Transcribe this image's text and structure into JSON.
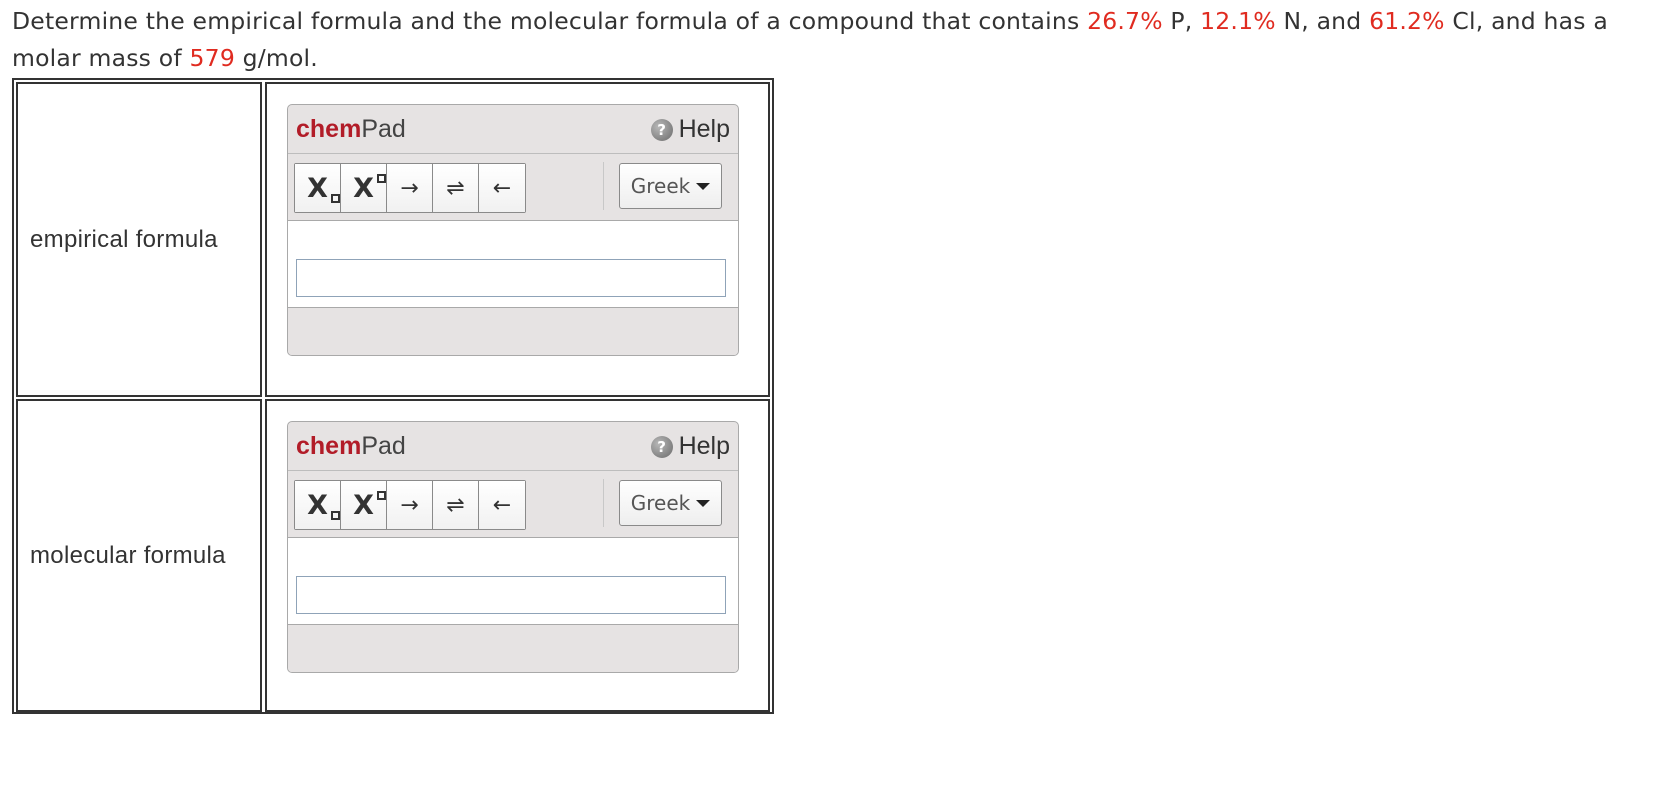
{
  "question": {
    "t1": "Determine the empirical formula and the molecular formula of a compound that contains ",
    "p_pct": "26.7%",
    "t2": " P, ",
    "n_pct": "12.1%",
    "t3": " N, and ",
    "cl_pct": "61.2%",
    "t4": " Cl, and has a molar mass of ",
    "molar_mass": "579",
    "t5": " g/mol."
  },
  "colors": {
    "highlight": "#e02b20",
    "brand_chem": "#b21c28"
  },
  "rows": [
    {
      "label": "empirical formula",
      "chempad": {
        "brand_bold": "chem",
        "brand_rest": "Pad",
        "help_label": "Help",
        "help_icon": "question-circle-icon",
        "tools": {
          "subscript": "X",
          "superscript": "X",
          "right_arrow": "→",
          "equilibrium": "⇌",
          "left_arrow": "←"
        },
        "greek_label": "Greek",
        "input_value": ""
      }
    },
    {
      "label": "molecular formula",
      "chempad": {
        "brand_bold": "chem",
        "brand_rest": "Pad",
        "help_label": "Help",
        "help_icon": "question-circle-icon",
        "tools": {
          "subscript": "X",
          "superscript": "X",
          "right_arrow": "→",
          "equilibrium": "⇌",
          "left_arrow": "←"
        },
        "greek_label": "Greek",
        "input_value": ""
      }
    }
  ]
}
